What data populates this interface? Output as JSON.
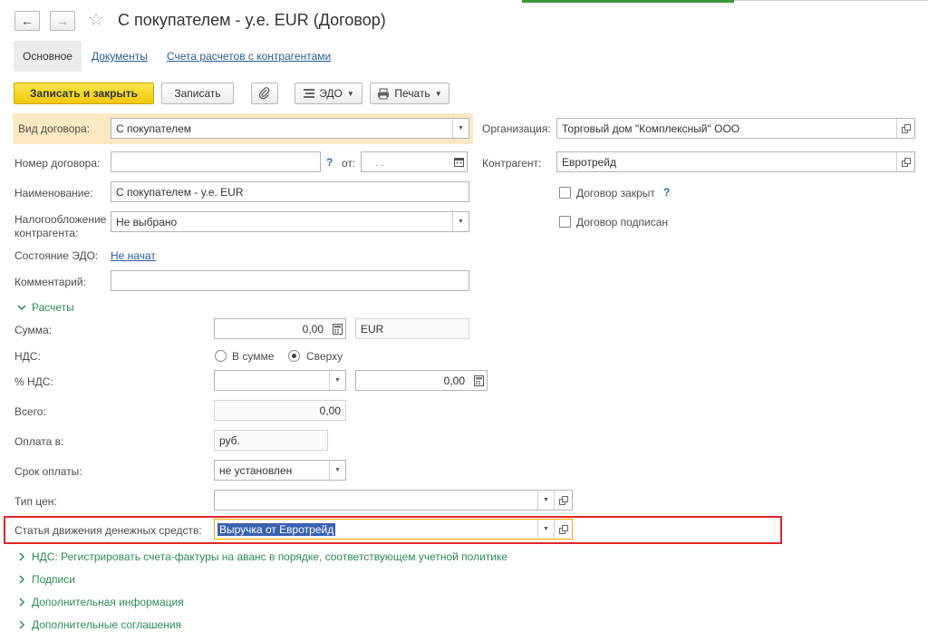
{
  "window": {
    "title": "С покупателем - у.е. EUR (Договор)"
  },
  "tabs": [
    {
      "label": "Основное",
      "active": true
    },
    {
      "label": "Документы"
    },
    {
      "label": "Счета расчетов с контрагентами"
    }
  ],
  "toolbar": {
    "save_close": "Записать и закрыть",
    "save": "Записать",
    "edo": "ЭДО",
    "print": "Печать"
  },
  "form": {
    "vid": {
      "label": "Вид договора:",
      "value": "С покупателем"
    },
    "nomer": {
      "label": "Номер договора:",
      "value": "",
      "q": "?",
      "ot_label": "от:",
      "date": ". ."
    },
    "naim": {
      "label": "Наименование:",
      "value": "С покупателем - у.е. EUR"
    },
    "nalog": {
      "label_line1": "Налогообложение",
      "label_line2": "контрагента:",
      "value": "Не выбрано"
    },
    "edo_state": {
      "label": "Состояние ЭДО:",
      "value": "Не начат"
    },
    "comment": {
      "label": "Комментарий:",
      "value": ""
    },
    "org": {
      "label": "Организация:",
      "value": "Торговый дом \"Комплексный\" ООО"
    },
    "kontr": {
      "label": "Контрагент:",
      "value": "Евротрейд"
    },
    "closed": {
      "label": "Договор закрыт",
      "q": "?",
      "checked": false
    },
    "signed": {
      "label": "Договор подписан",
      "checked": false
    }
  },
  "raschety": {
    "section": "Расчеты",
    "summa": {
      "label": "Сумма:",
      "value": "0,00",
      "currency": "EUR"
    },
    "nds": {
      "label": "НДС:",
      "opt1": "В сумме",
      "opt2": "Сверху",
      "selected": "Сверху"
    },
    "pnds": {
      "label": "% НДС:",
      "value": "",
      "amount": "0,00"
    },
    "vsego": {
      "label": "Всего:",
      "value": "0,00"
    },
    "oplata": {
      "label": "Оплата в:",
      "value": "руб."
    },
    "srok": {
      "label": "Срок оплаты:",
      "value": "не установлен"
    },
    "tipcen": {
      "label": "Тип цен:",
      "value": ""
    },
    "statya": {
      "label": "Статья движения денежных средств:",
      "value": "Выручка от Евротрейд"
    }
  },
  "sections": [
    "НДС: Регистрировать счета-фактуры на аванс в порядке, соответствующем учетной политике",
    "Подписи",
    "Дополнительная информация",
    "Дополнительные соглашения"
  ],
  "colors": {
    "accent_yellow": "#f1c80c",
    "section_green": "#2e8b57",
    "highlight_red": "#e0262a",
    "link_blue": "#2a5c9a"
  }
}
